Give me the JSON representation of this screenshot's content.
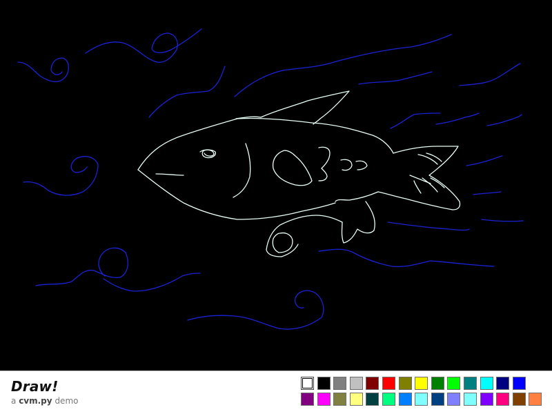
{
  "app": {
    "title": "Draw!",
    "subtitle_prefix": "a",
    "subtitle_lib": "cvm.py",
    "subtitle_suffix": "demo"
  },
  "palette": {
    "selected_index": 0,
    "colors": [
      "#ffffff",
      "#000000",
      "#808080",
      "#c0c0c0",
      "#800000",
      "#ff0000",
      "#808000",
      "#ffff00",
      "#008000",
      "#00ff00",
      "#008080",
      "#00ffff",
      "#000080",
      "#0000ff",
      "#800080",
      "#ff00ff",
      "#808040",
      "#ffff80",
      "#004040",
      "#00ff80",
      "#0080ff",
      "#80ffff",
      "#004080",
      "#8080ff",
      "#80ffff",
      "#8000ff",
      "#ff0080",
      "#804000",
      "#ff8040"
    ]
  },
  "drawing": {
    "colors": {
      "outline": "#e8fff8",
      "water": "#1a22d6"
    }
  }
}
